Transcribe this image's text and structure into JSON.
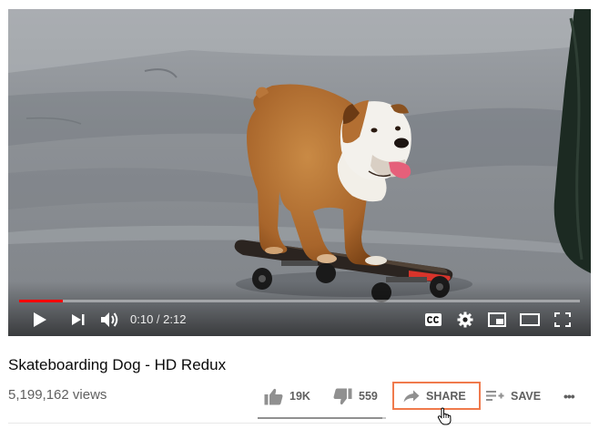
{
  "player": {
    "progress_fraction": 0.078,
    "current_time": "0:10",
    "time_separator": " / ",
    "duration": "2:12",
    "accent_color": "#ff0000",
    "controls": [
      "play-icon",
      "next-icon",
      "volume-icon",
      "captions-icon",
      "settings-icon",
      "miniplayer-icon",
      "theater-icon",
      "fullscreen-icon"
    ]
  },
  "video": {
    "title": "Skateboarding Dog - HD Redux",
    "views": "5,199,162 views"
  },
  "actions": {
    "like_count": "19K",
    "dislike_count": "559",
    "share_label": "SHARE",
    "save_label": "SAVE",
    "more_label": "•••",
    "like_ratio": 0.97,
    "highlight_color": "#f07a4c"
  }
}
